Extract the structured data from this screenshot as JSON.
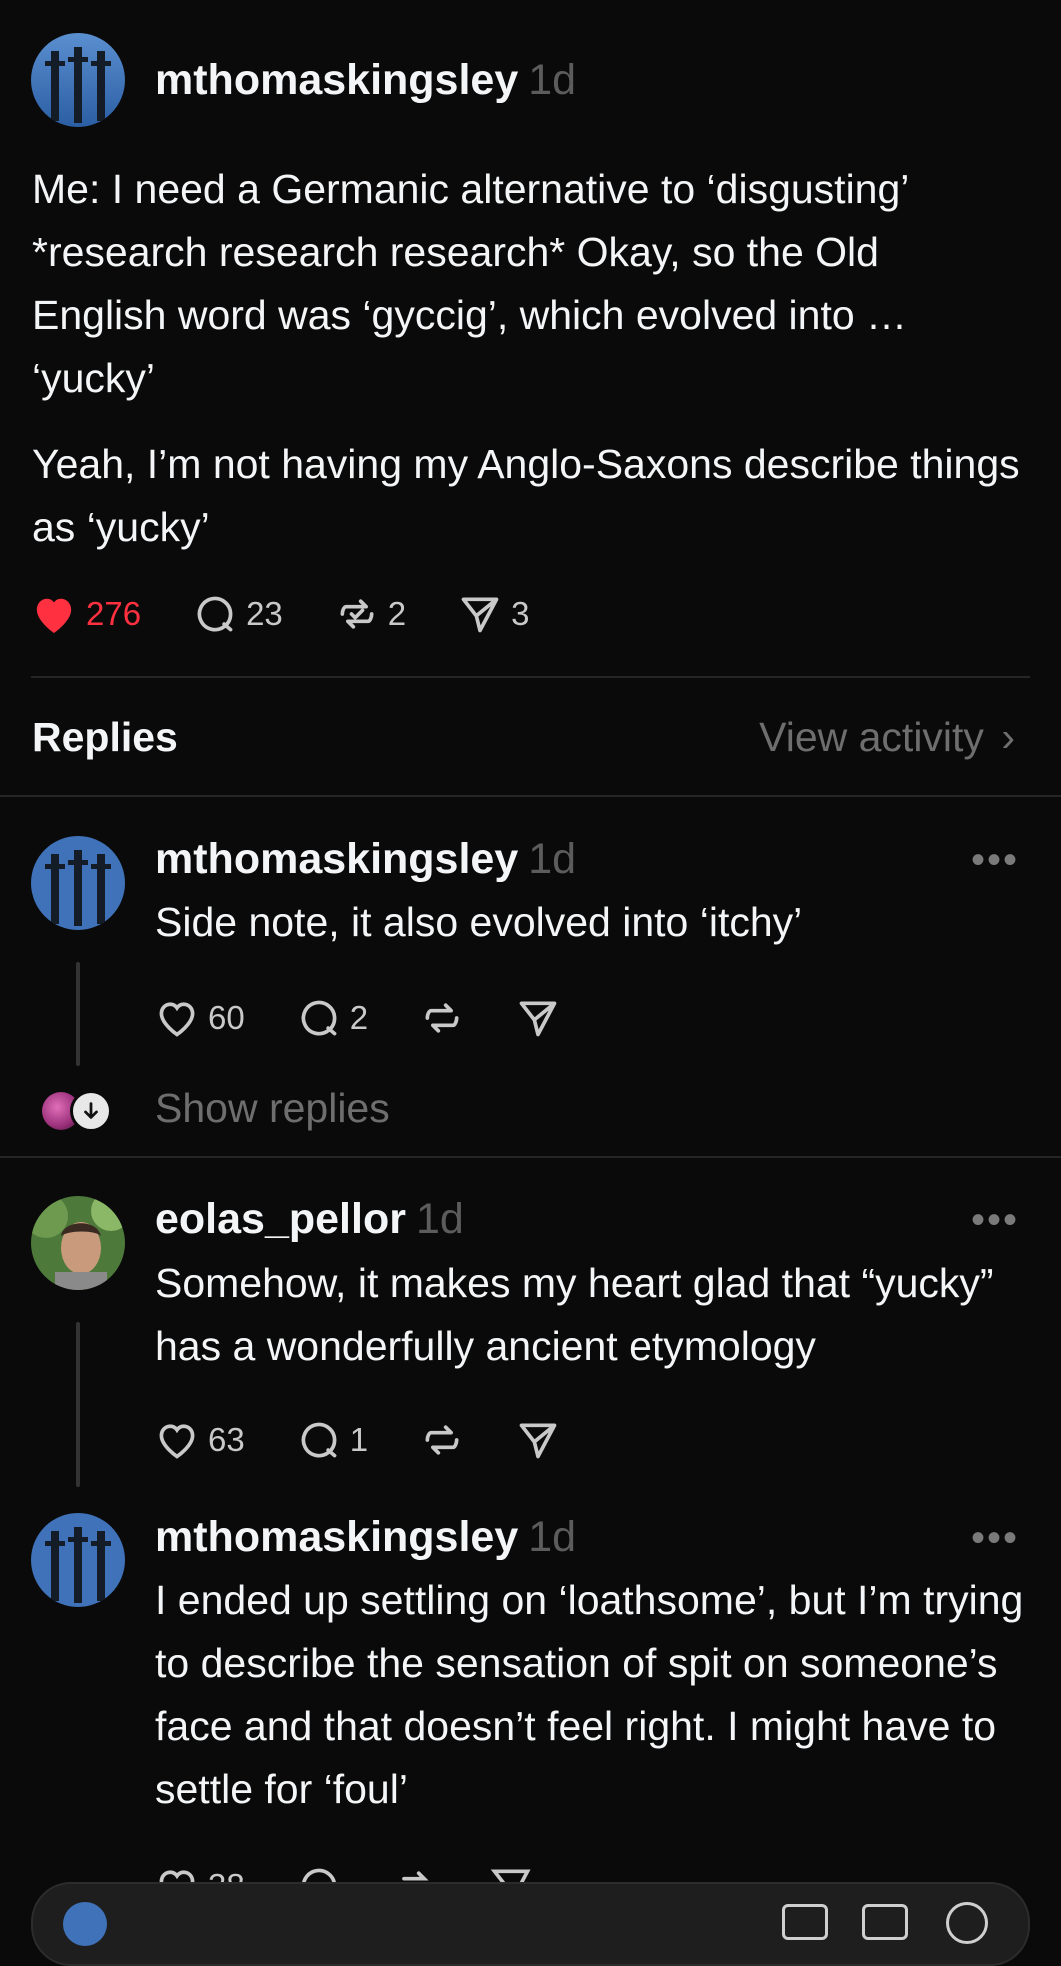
{
  "main_post": {
    "username": "mthomaskingsley",
    "time": "1d",
    "paragraph1": "Me: I need a Germanic alternative to ‘disgusting’ *research research research* Okay, so the Old English word was ‘gyccig’, which evolved into … ‘yucky’",
    "paragraph2": "Yeah, I’m not having my Anglo-Saxons describe things as ‘yucky’",
    "likes": "276",
    "comments": "23",
    "reposts": "2",
    "shares": "3",
    "like_color": "#ff3040"
  },
  "replies_header": {
    "title": "Replies",
    "view_activity": "View activity",
    "chevron": "›"
  },
  "replies": [
    {
      "username": "mthomaskingsley",
      "time": "1d",
      "text": "Side note, it also evolved into ‘itchy’",
      "likes": "60",
      "comments": "2",
      "more": "•••",
      "show_replies": "Show replies"
    },
    {
      "username": "eolas_pellor",
      "time": "1d",
      "text": "Somehow, it makes my heart glad that “yucky” has a wonderfully ancient etymology",
      "likes": "63",
      "comments": "1",
      "more": "•••"
    },
    {
      "username": "mthomaskingsley",
      "time": "1d",
      "text": "I ended up settling on ‘loathsome’, but I’m trying to describe the sensation of spit on someone’s face and that doesn’t feel right. I might have to settle for ‘foul’",
      "likes": "38",
      "more": "•••"
    }
  ]
}
